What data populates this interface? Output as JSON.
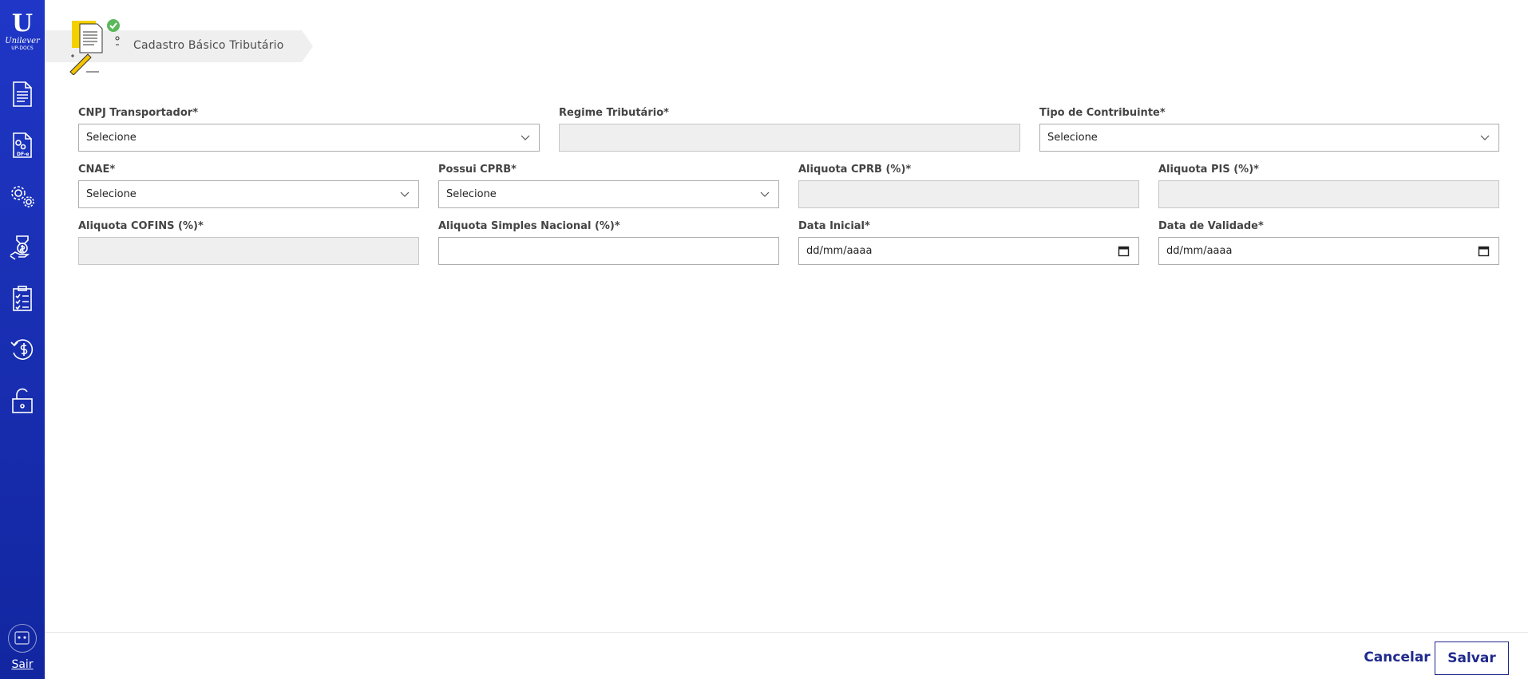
{
  "sidebar": {
    "logo": {
      "mark": "U",
      "word": "Unilever",
      "sub": "UP-DOCS"
    },
    "items": [
      {
        "icon": "document-icon"
      },
      {
        "icon": "dfe-settings-document-icon",
        "text": "DF-e"
      },
      {
        "icon": "gears-icon"
      },
      {
        "icon": "money-hand-icon"
      },
      {
        "icon": "checklist-clipboard-icon"
      },
      {
        "icon": "refund-dollar-icon"
      },
      {
        "icon": "unlock-icon"
      }
    ],
    "logout_label": "Sair"
  },
  "breadcrumb": {
    "title": "Cadastro Básico Tributário"
  },
  "form": {
    "cnpj_transportador": {
      "label": "CNPJ Transportador*",
      "value": "Selecione"
    },
    "regime_tributario": {
      "label": "Regime Tributário*",
      "value": ""
    },
    "tipo_contribuinte": {
      "label": "Tipo de Contribuinte*",
      "value": "Selecione"
    },
    "cnae": {
      "label": "CNAE*",
      "value": "Selecione"
    },
    "possui_cprb": {
      "label": "Possui CPRB*",
      "value": "Selecione"
    },
    "aliquota_cprb": {
      "label": "Aliquota CPRB (%)*",
      "value": ""
    },
    "aliquota_pis": {
      "label": "Aliquota PIS (%)*",
      "value": ""
    },
    "aliquota_cofins": {
      "label": "Aliquota COFINS (%)*",
      "value": ""
    },
    "aliquota_simples": {
      "label": "Aliquota Simples Nacional (%)*",
      "value": ""
    },
    "data_inicial": {
      "label": "Data Inicial*",
      "placeholder": "dd/mm/aaaa"
    },
    "data_validade": {
      "label": "Data de Validade*",
      "placeholder": "dd/mm/aaaa"
    }
  },
  "footer": {
    "cancel_label": "Cancelar",
    "save_label": "Salvar"
  },
  "colors": {
    "sidebar": "#1a30b5",
    "accent": "#1f2a8c",
    "breadcrumb_bg": "#efefef",
    "check_green": "#5cb85c",
    "folder_yellow": "#f5d000"
  }
}
